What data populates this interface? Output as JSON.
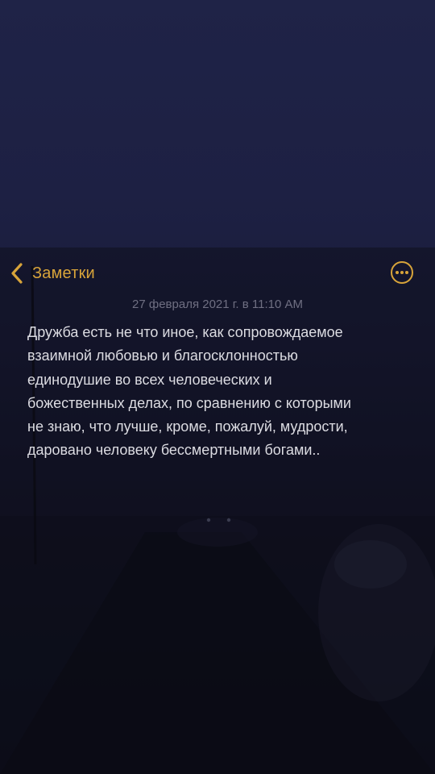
{
  "nav": {
    "back_label": "Заметки",
    "back_icon": "chevron-left-icon",
    "more_icon": "more-circle-icon"
  },
  "note": {
    "date": "27 февраля 2021 г. в 11:10 AM",
    "lines": [
      "Дружба есть не что иное, как сопровождаемое",
      "взаимной любовью и благосклонностью",
      "единодушие во всех человеческих и",
      "божественных делах, по сравнению с которыми",
      "не знаю, что лучше, кроме, пожалуй, мудрости,",
      "даровано человеку бессмертными богами.."
    ]
  },
  "colors": {
    "accent": "#d8a43a",
    "text": "#dcdce2",
    "date_text": "#6f6f82",
    "background": "#1d1f3d"
  }
}
